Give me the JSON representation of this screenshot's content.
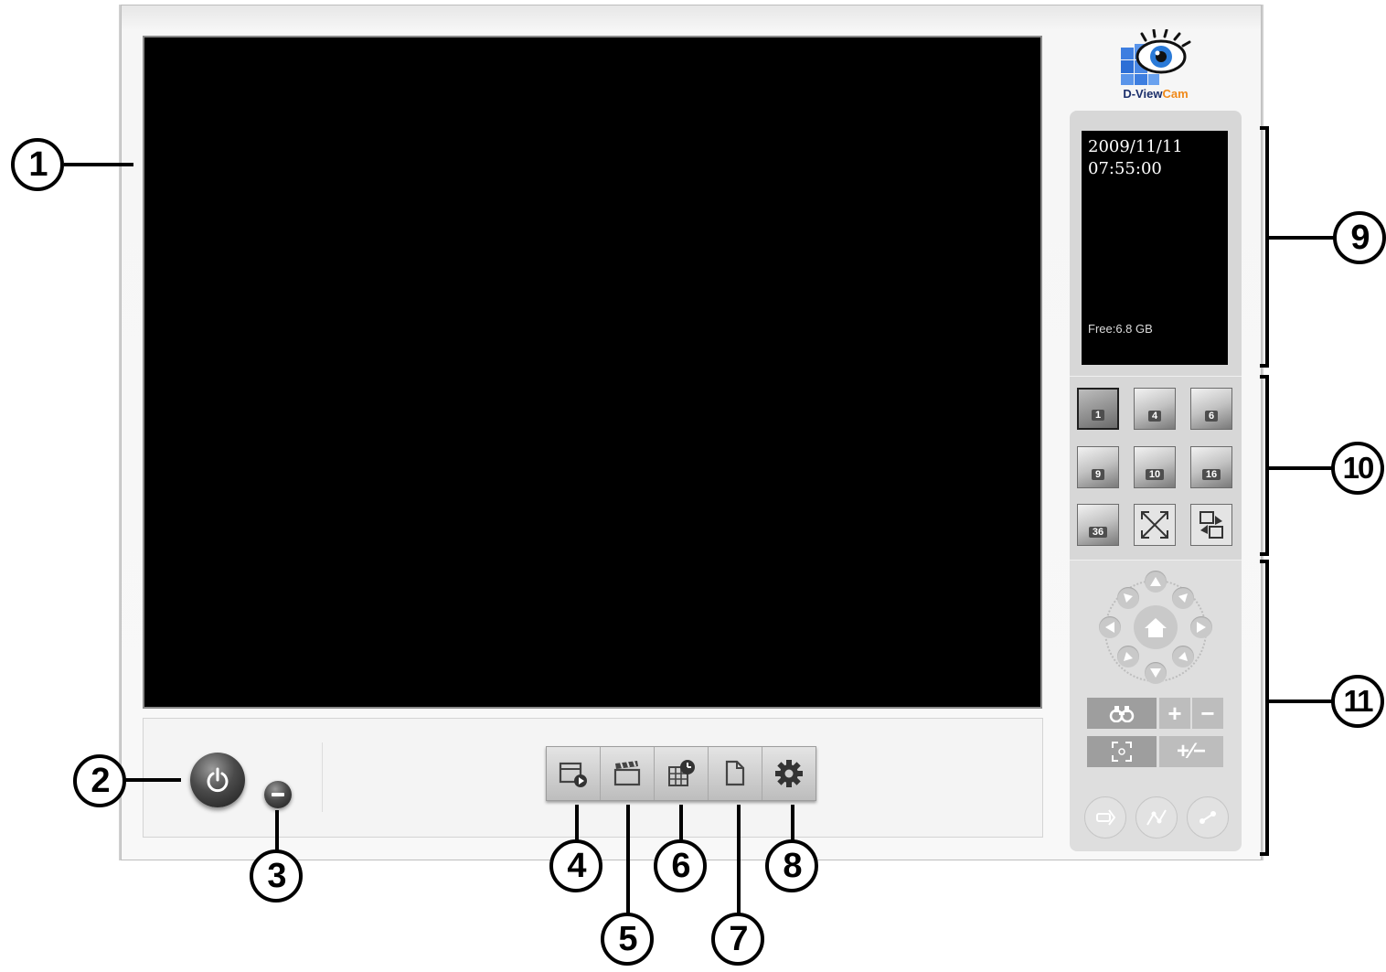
{
  "app": {
    "logo_brand_part1": "D-View",
    "logo_brand_part2": "Cam",
    "brand_colors": {
      "navy": "#1c2f6b",
      "orange": "#f08a1a",
      "blue": "#2d6fd6"
    }
  },
  "info_panel": {
    "date": "2009/11/11",
    "time": "07:55:00",
    "free_space": "Free:6.8 GB"
  },
  "layout_buttons": [
    {
      "label": "1",
      "active": true
    },
    {
      "label": "4"
    },
    {
      "label": "6"
    },
    {
      "label": "9"
    },
    {
      "label": "10"
    },
    {
      "label": "16"
    },
    {
      "label": "36"
    },
    {
      "label": "",
      "icon": "fullscreen-icon"
    },
    {
      "label": "",
      "icon": "auto-switch-icon"
    }
  ],
  "toolbar": {
    "items": [
      {
        "icon": "playback-icon"
      },
      {
        "icon": "clapper-icon"
      },
      {
        "icon": "schedule-icon"
      },
      {
        "icon": "document-icon"
      },
      {
        "icon": "gear-icon"
      }
    ]
  },
  "ptz": {
    "zoom_in_label": "+",
    "zoom_out_label": "−",
    "zoom_toggle_label": "+∕−"
  },
  "callouts": [
    "1",
    "2",
    "3",
    "4",
    "5",
    "6",
    "7",
    "8",
    "9",
    "10",
    "11"
  ]
}
